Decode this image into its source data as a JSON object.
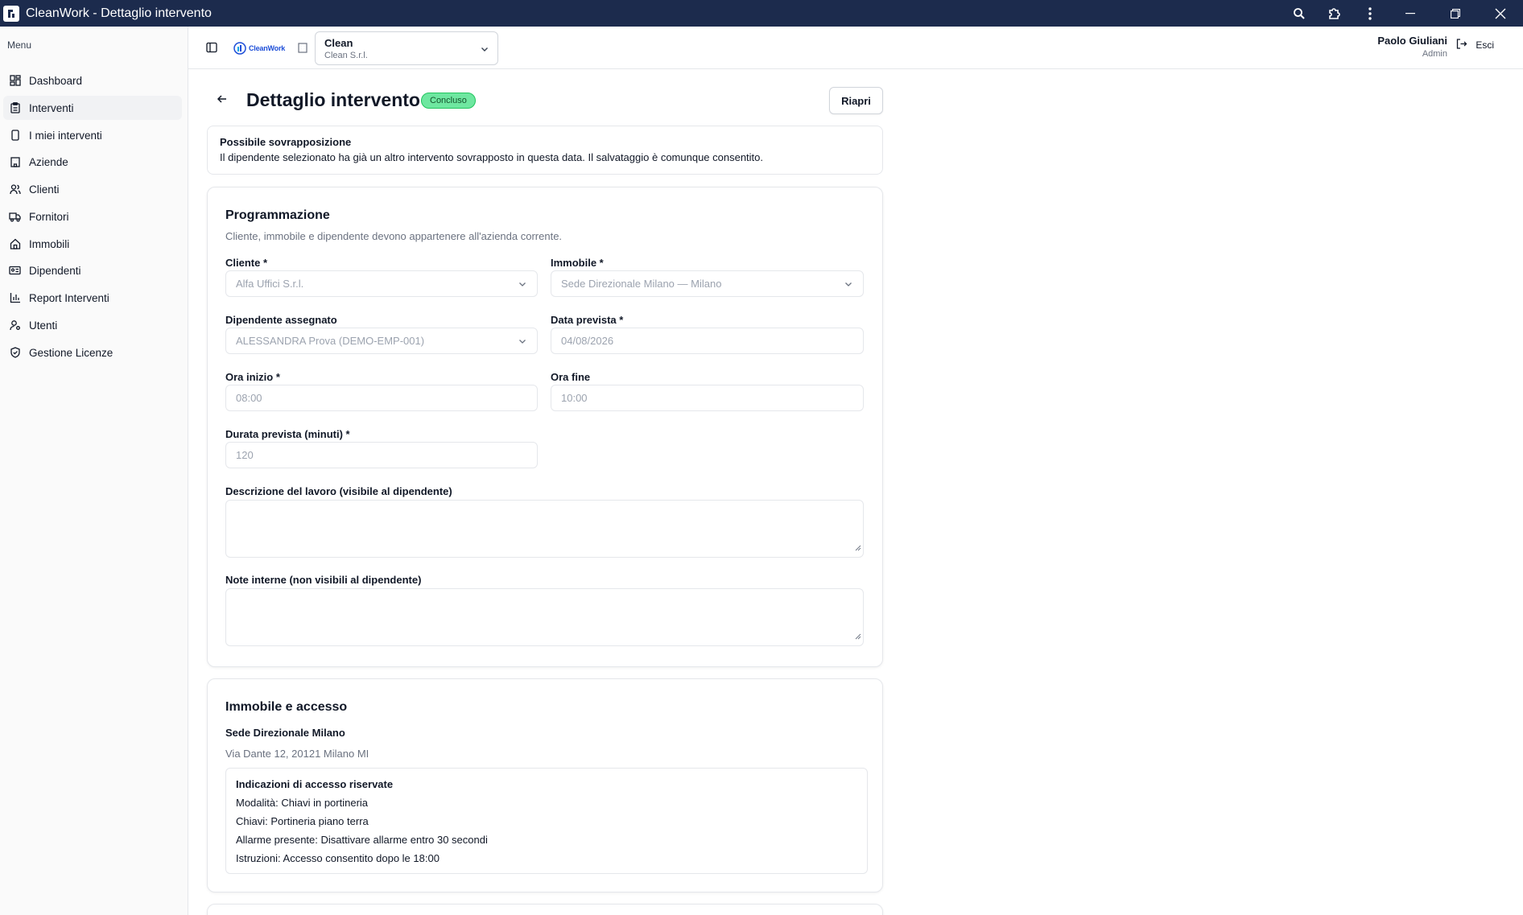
{
  "window": {
    "title": "CleanWork - Dettaglio intervento"
  },
  "sidebar": {
    "menu_label": "Menu",
    "items": [
      {
        "label": "Dashboard",
        "icon": "grid-icon"
      },
      {
        "label": "Interventi",
        "icon": "clipboard-icon",
        "active": true
      },
      {
        "label": "I miei interventi",
        "icon": "phone-icon"
      },
      {
        "label": "Aziende",
        "icon": "building-icon"
      },
      {
        "label": "Clienti",
        "icon": "users-icon"
      },
      {
        "label": "Fornitori",
        "icon": "truck-icon"
      },
      {
        "label": "Immobili",
        "icon": "home-icon"
      },
      {
        "label": "Dipendenti",
        "icon": "id-card-icon"
      },
      {
        "label": "Report Interventi",
        "icon": "bar-chart-icon"
      },
      {
        "label": "Utenti",
        "icon": "user-cog-icon"
      },
      {
        "label": "Gestione Licenze",
        "icon": "shield-check-icon"
      }
    ]
  },
  "topbar": {
    "logo_text": "CleanWork",
    "company": {
      "name": "Clean",
      "sub": "Clean S.r.l."
    },
    "user": {
      "name": "Paolo Giuliani",
      "role": "Admin"
    },
    "logout_label": "Esci"
  },
  "page": {
    "title": "Dettaglio intervento",
    "status": "Concluso",
    "reopen_label": "Riapri"
  },
  "alert": {
    "title": "Possibile sovrapposizione",
    "text": "Il dipendente selezionato ha già un altro intervento sovrapposto in questa data. Il salvataggio è comunque consentito."
  },
  "programmazione": {
    "title": "Programmazione",
    "subtitle": "Cliente, immobile e dipendente devono appartenere all'azienda corrente.",
    "cliente": {
      "label": "Cliente *",
      "value": "Alfa Uffici S.r.l."
    },
    "immobile": {
      "label": "Immobile *",
      "value": "Sede Direzionale Milano — Milano"
    },
    "dipendente": {
      "label": "Dipendente assegnato",
      "value": "ALESSANDRA Prova (DEMO-EMP-001)"
    },
    "data_prevista": {
      "label": "Data prevista *",
      "value": "04/08/2026"
    },
    "ora_inizio": {
      "label": "Ora inizio *",
      "value": "08:00"
    },
    "ora_fine": {
      "label": "Ora fine",
      "value": "10:00"
    },
    "durata": {
      "label": "Durata prevista (minuti) *",
      "value": "120"
    },
    "descrizione": {
      "label": "Descrizione del lavoro (visibile al dipendente)"
    },
    "note": {
      "label": "Note interne (non visibili al dipendente)"
    }
  },
  "immobile_accesso": {
    "title": "Immobile e accesso",
    "name": "Sede Direzionale Milano",
    "address": "Via Dante 12, 20121 Milano MI",
    "access": {
      "title": "Indicazioni di accesso riservate",
      "modalita": "Modalità: Chiavi in portineria",
      "chiavi": "Chiavi: Portineria piano terra",
      "allarme": "Allarme presente: Disattivare allarme entro 30 secondi",
      "istruzioni": "Istruzioni: Accesso consentito dopo le 18:00"
    }
  }
}
